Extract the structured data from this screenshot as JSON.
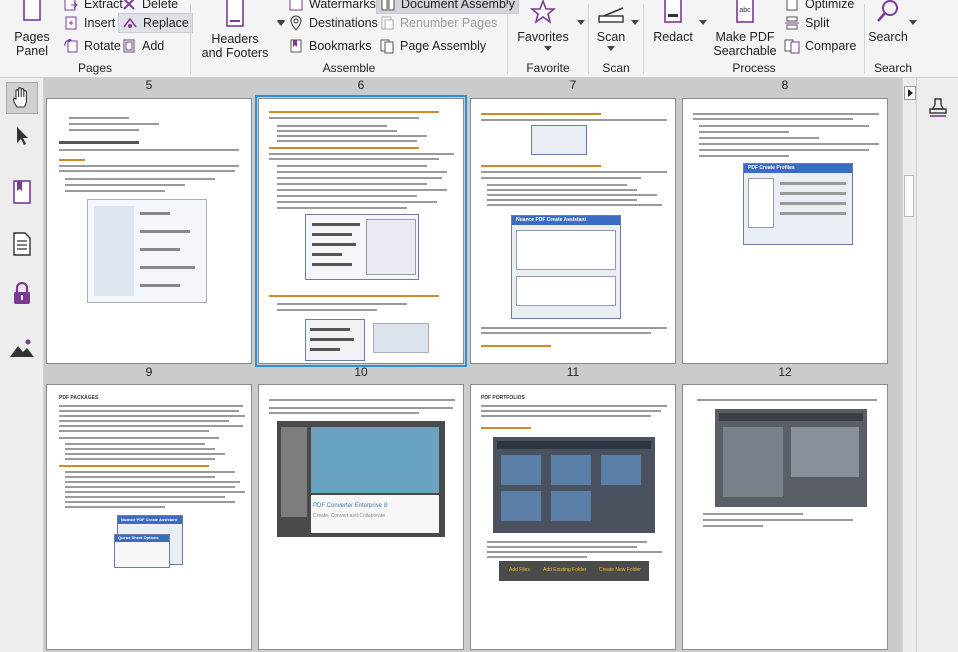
{
  "ribbon": {
    "groups": [
      {
        "id": "pages",
        "label": "Pages"
      },
      {
        "id": "assemble",
        "label": "Assemble"
      },
      {
        "id": "favorite",
        "label": "Favorite"
      },
      {
        "id": "scan",
        "label": "Scan"
      },
      {
        "id": "process",
        "label": "Process"
      },
      {
        "id": "search",
        "label": "Search"
      }
    ],
    "pages_panel": "Pages Panel",
    "extract": "Extract",
    "insert": "Insert",
    "rotate": "Rotate",
    "delete": "Delete",
    "replace": "Replace",
    "add": "Add",
    "headers_footers": "Headers and Footers",
    "watermarks": "Watermarks",
    "destinations": "Destinations",
    "bookmarks": "Bookmarks",
    "document_assembly": "Document Assembly",
    "renumber_pages": "Renumber Pages",
    "page_assembly": "Page Assembly",
    "favorites": "Favorites",
    "scan": "Scan",
    "redact": "Redact",
    "make_pdf_searchable": "Make PDF Searchable",
    "optimize": "Optimize",
    "split": "Split",
    "compare": "Compare",
    "search": "Search"
  },
  "pages": [
    {
      "number": "5"
    },
    {
      "number": "6"
    },
    {
      "number": "7"
    },
    {
      "number": "8"
    },
    {
      "number": "9"
    },
    {
      "number": "10"
    },
    {
      "number": "11"
    },
    {
      "number": "12"
    }
  ],
  "thumb_text": {
    "p7_dialog": "Nuance PDF Create Assistant",
    "p8_dialog": "PDF Create Profiles",
    "p9_heading": "PDF PACKAGES",
    "p9_dialog": "Nuance PDF Create Assistant",
    "p9_sub": "Queue Sheet Options",
    "p10_caption": "PDF Converter Enterprise 8",
    "p10_tag": "Create, Convert and Collaborate",
    "p11_heading": "PDF PORTFOLIOS",
    "p11_b1": "Add Files",
    "p11_b2": "Add Existing Folder",
    "p11_b3": "Create New Folder"
  },
  "colors": {
    "accent_purple": "#7a3a96",
    "selection_blue": "#2e8fd4"
  }
}
